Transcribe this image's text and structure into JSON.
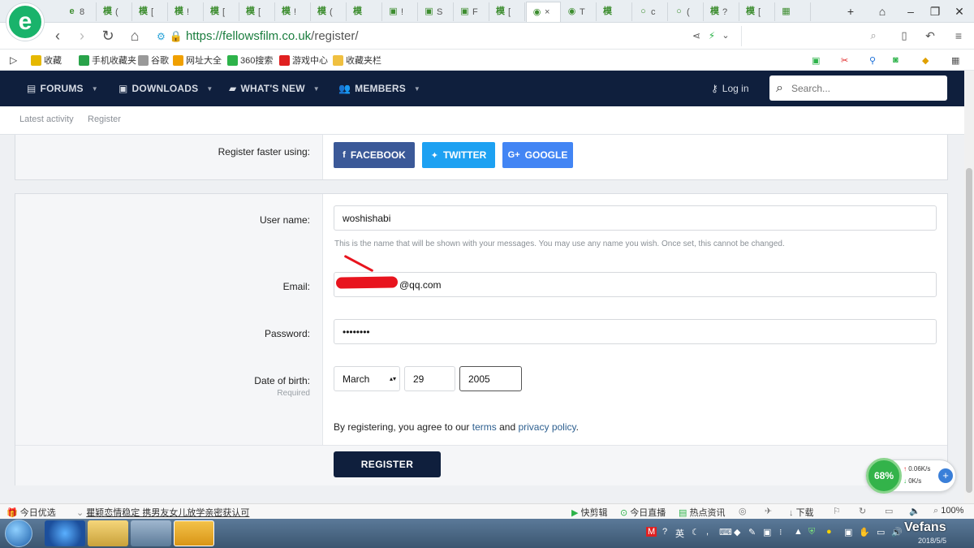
{
  "browser": {
    "tabs": [
      {
        "glyph": "e",
        "label": "8",
        "active": false
      },
      {
        "glyph": "模",
        "label": "(",
        "active": false
      },
      {
        "glyph": "模",
        "label": "[",
        "active": false
      },
      {
        "glyph": "模",
        "label": "!",
        "active": false
      },
      {
        "glyph": "模",
        "label": "[",
        "active": false
      },
      {
        "glyph": "模",
        "label": "[",
        "active": false
      },
      {
        "glyph": "模",
        "label": "!",
        "active": false
      },
      {
        "glyph": "模",
        "label": "(",
        "active": false
      },
      {
        "glyph": "模",
        "label": "",
        "active": false
      },
      {
        "glyph": "▣",
        "label": "!",
        "active": false
      },
      {
        "glyph": "▣",
        "label": "S",
        "active": false
      },
      {
        "glyph": "▣",
        "label": "F",
        "active": false
      },
      {
        "glyph": "模",
        "label": "[",
        "active": false
      },
      {
        "glyph": "◉",
        "label": "×",
        "active": true
      },
      {
        "glyph": "◉",
        "label": "T",
        "active": false
      },
      {
        "glyph": "模",
        "label": "",
        "active": false
      },
      {
        "glyph": "○",
        "label": "c",
        "active": false
      },
      {
        "glyph": "○",
        "label": "(",
        "active": false
      },
      {
        "glyph": "模",
        "label": "?",
        "active": false
      },
      {
        "glyph": "模",
        "label": "[",
        "active": false
      },
      {
        "glyph": "▦",
        "label": "",
        "active": false
      }
    ],
    "new_tab_symbol": "+",
    "url_host": "https://fellowsfilm.co.uk",
    "url_path": "/register/",
    "bookmarks": [
      {
        "label": "收藏",
        "color": "#e6b800"
      },
      {
        "label": "手机收藏夹",
        "color": "#29a34a"
      },
      {
        "label": "谷歌",
        "color": "#999999"
      },
      {
        "label": "网址大全",
        "color": "#f0a000"
      },
      {
        "label": "360搜索",
        "color": "#2db34a"
      },
      {
        "label": "游戏中心",
        "color": "#e02020"
      },
      {
        "label": "收藏夹栏",
        "color": "#f0c040"
      }
    ]
  },
  "site": {
    "nav": [
      {
        "label": "FORUMS",
        "icon": "forums-icon"
      },
      {
        "label": "DOWNLOADS",
        "icon": "downloads-icon"
      },
      {
        "label": "WHAT'S NEW",
        "icon": "whats-new-icon"
      },
      {
        "label": "MEMBERS",
        "icon": "members-icon"
      }
    ],
    "login_label": "Log in",
    "search_placeholder": "Search...",
    "subnav": [
      "Latest activity",
      "Register"
    ]
  },
  "form": {
    "register_faster_label": "Register faster using:",
    "social": [
      {
        "label": "FACEBOOK",
        "color": "#3b5998",
        "glyph": "f"
      },
      {
        "label": "TWITTER",
        "color": "#1da1f2",
        "glyph": "🐦"
      },
      {
        "label": "GOOGLE",
        "color": "#4285f4",
        "glyph": "G+"
      }
    ],
    "username_label": "User name:",
    "username_value": "woshishabi",
    "username_hint": "This is the name that will be shown with your messages. You may use any name you wish. Once set, this cannot be changed.",
    "email_label": "Email:",
    "email_value": "@qq.com",
    "password_label": "Password:",
    "password_value": "••••••••",
    "dob_label": "Date of birth:",
    "dob_required": "Required",
    "dob_month": "March",
    "dob_day": "29",
    "dob_year": "2005",
    "agree_prefix": "By registering, you agree to our ",
    "terms_link": "terms",
    "agree_and": " and ",
    "privacy_link": "privacy policy",
    "agree_suffix": ".",
    "register_button": "REGISTER"
  },
  "widget": {
    "cpu_percent": "68%",
    "upload": "0.06K/s",
    "download": "0K/s"
  },
  "statusbar": {
    "today_pick": "今日优选",
    "headline": "瞿颖恋情稳定 携男友女儿放学亲密获认可",
    "kuaijian": "快剪辑",
    "today_live": "今日直播",
    "hot_news": "热点资讯",
    "download": "下载",
    "zoom": "100%"
  },
  "taskbar": {
    "ime": "英",
    "date": "2018/5/5",
    "watermark": "Vefans"
  }
}
